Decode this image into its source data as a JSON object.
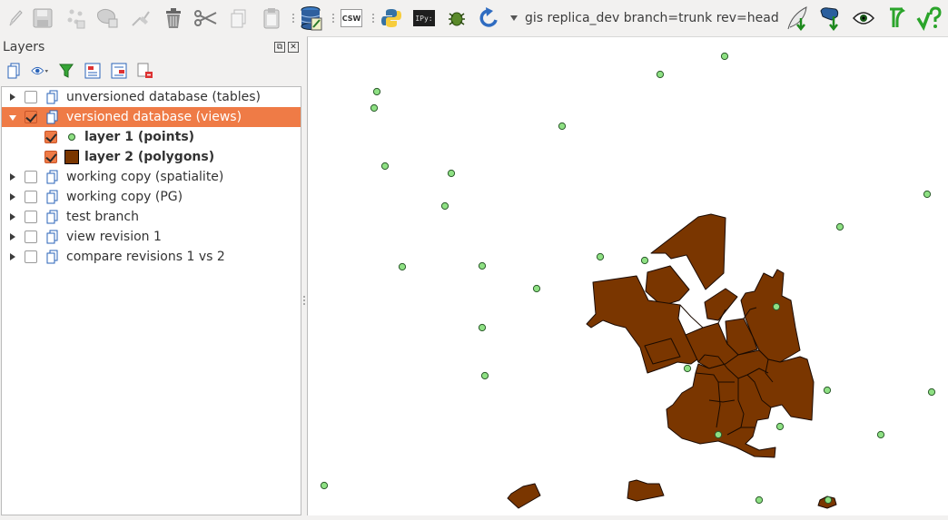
{
  "toolbar": {
    "project_label": "gis replica_dev branch=trunk rev=head",
    "icons": [
      "pencil-icon",
      "save-edits-icon",
      "add-feature-icon",
      "move-feature-icon",
      "node-tool-icon",
      "delete-icon",
      "cut-icon",
      "copy-icon",
      "paste-icon",
      "database-icon",
      "csw-icon",
      "python-icon",
      "ipython-icon",
      "bug-icon",
      "refresh-icon",
      "dropdown-icon",
      "pull-icon",
      "update-icon",
      "view-icon",
      "branch-icon",
      "commit-icon"
    ],
    "csw_text": "CSW",
    "ipy_text": "IPy:"
  },
  "layers_panel": {
    "title": "Layers",
    "header_buttons": [
      "float-icon",
      "close-icon"
    ],
    "tools": [
      "add-group-icon",
      "visibility-icon",
      "filter-icon",
      "expand-all-icon",
      "collapse-all-icon",
      "remove-layer-icon"
    ],
    "tree": [
      {
        "label": "unversioned database (tables)",
        "type": "group",
        "checked": false,
        "expanded": false,
        "selected": false
      },
      {
        "label": "versioned database (views)",
        "type": "group",
        "checked": true,
        "expanded": true,
        "selected": true
      },
      {
        "label": "layer 1 (points)",
        "type": "point-layer",
        "checked": true,
        "bold": true
      },
      {
        "label": "layer 2 (polygons)",
        "type": "polygon-layer",
        "checked": true,
        "bold": true
      },
      {
        "label": "working copy (spatialite)",
        "type": "group",
        "checked": false,
        "expanded": false
      },
      {
        "label": "working copy (PG)",
        "type": "group",
        "checked": false,
        "expanded": false
      },
      {
        "label": "test branch",
        "type": "group",
        "checked": false,
        "expanded": false
      },
      {
        "label": "view revision 1",
        "type": "group",
        "checked": false,
        "expanded": false
      },
      {
        "label": "compare revisions 1 vs 2",
        "type": "group",
        "checked": false,
        "expanded": false
      }
    ]
  },
  "colors": {
    "selection": "#ef7b46",
    "point_fill": "#8ee083",
    "point_stroke": "#2b5a2b",
    "polygon_fill": "#7a3600",
    "polygon_stroke": "#1a0a00"
  }
}
